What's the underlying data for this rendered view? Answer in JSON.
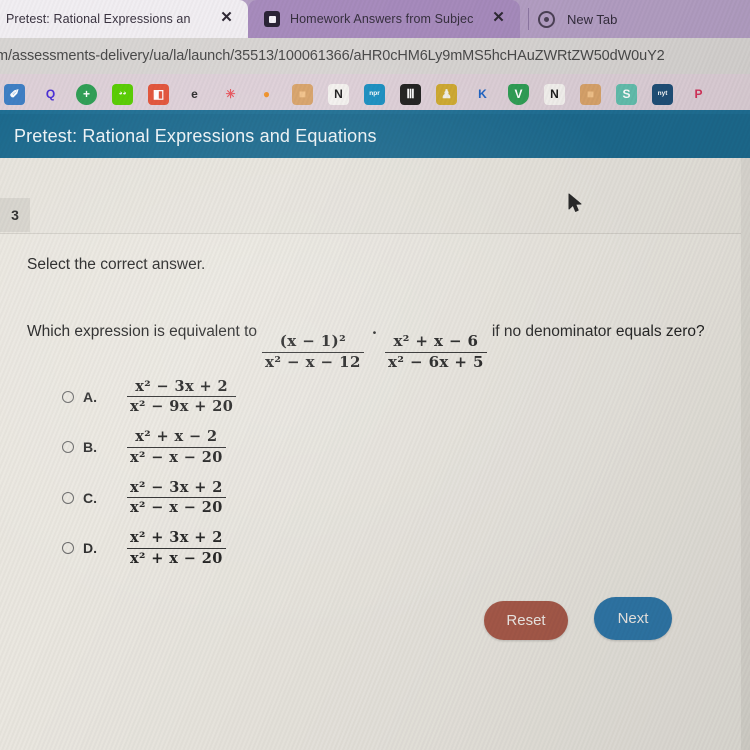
{
  "browser": {
    "tabs": [
      {
        "title": "Pretest: Rational Expressions an",
        "close": "✕",
        "favicon": "none",
        "active": true
      },
      {
        "title": "Homework Answers from Subjec",
        "close": "✕",
        "favicon": "brainly-icon",
        "active": false
      }
    ],
    "new_tab_label": "New Tab",
    "url": "m/assessments-delivery/ua/la/launch/35513/100061366/aHR0cHM6Ly9mMS5hcHAuZWRtZW50dW0uY2",
    "bookmarks": [
      {
        "name": "bookmark-docs",
        "glyph": "✐",
        "bg": "#3f7fc4",
        "fg": "#ffffff",
        "shape": "square"
      },
      {
        "name": "bookmark-quizlet",
        "glyph": "Q",
        "bg": "#ded0d8",
        "fg": "#4a2fd6",
        "shape": "square"
      },
      {
        "name": "bookmark-addplus",
        "glyph": "+",
        "bg": "#2f9e55",
        "fg": "#ffffff",
        "shape": "round"
      },
      {
        "name": "bookmark-duolingo",
        "glyph": "◕◕",
        "bg": "#58cc02",
        "fg": "#ffffff",
        "shape": "square"
      },
      {
        "name": "bookmark-office",
        "glyph": "◧",
        "bg": "#e2543a",
        "fg": "#ffffff",
        "shape": "square"
      },
      {
        "name": "bookmark-edge",
        "glyph": "e",
        "bg": "#ded0d8",
        "fg": "#2b2b2b",
        "shape": "round"
      },
      {
        "name": "bookmark-asterisk",
        "glyph": "✳",
        "bg": "#ded0d8",
        "fg": "#e8545c",
        "shape": "round"
      },
      {
        "name": "bookmark-balloon",
        "glyph": "●",
        "bg": "#ded0d8",
        "fg": "#f0922a",
        "shape": "round"
      },
      {
        "name": "bookmark-photo",
        "glyph": "■",
        "bg": "#d8a36a",
        "fg": "#f2c28a",
        "shape": "square"
      },
      {
        "name": "bookmark-notion",
        "glyph": "N",
        "bg": "#f4f2ef",
        "fg": "#1d1d1d",
        "shape": "square"
      },
      {
        "name": "bookmark-npr",
        "glyph": "npr",
        "bg": "#1a8fc1",
        "fg": "#ffffff",
        "shape": "square"
      },
      {
        "name": "bookmark-columns",
        "glyph": "Ⅲ",
        "bg": "#20201f",
        "fg": "#ffffff",
        "shape": "square"
      },
      {
        "name": "bookmark-person",
        "glyph": "♟",
        "bg": "#cfa92f",
        "fg": "#f2f0e6",
        "shape": "square"
      },
      {
        "name": "bookmark-kaplan",
        "glyph": "K",
        "bg": "#ded0d8",
        "fg": "#1d63c4",
        "shape": "square"
      },
      {
        "name": "bookmark-vpnshield",
        "glyph": "V",
        "bg": "#2f9e55",
        "fg": "#ffffff",
        "shape": "shield"
      },
      {
        "name": "bookmark-notion-2",
        "glyph": "N",
        "bg": "#f4f2ef",
        "fg": "#1d1d1d",
        "shape": "square"
      },
      {
        "name": "bookmark-photo-2",
        "glyph": "■",
        "bg": "#d8a36a",
        "fg": "#f2c28a",
        "shape": "square"
      },
      {
        "name": "bookmark-sheets",
        "glyph": "S",
        "bg": "#63bfae",
        "fg": "#ffffff",
        "shape": "square"
      },
      {
        "name": "bookmark-nyt",
        "glyph": "nyt",
        "bg": "#1f4f78",
        "fg": "#ffffff",
        "shape": "square"
      },
      {
        "name": "bookmark-pinterest",
        "glyph": "P",
        "bg": "#ded0d8",
        "fg": "#d4325a",
        "shape": "round"
      }
    ]
  },
  "page": {
    "title": "Pretest: Rational Expressions and Equations",
    "question_number": "3",
    "instruction": "Select the correct answer.",
    "question": {
      "lead_text": "Which expression is equivalent to",
      "expr1": {
        "numerator": "(x − 1)²",
        "denominator": "x² − x − 12"
      },
      "operator": "·",
      "expr2": {
        "numerator": "x² + x − 6",
        "denominator": "x² − 6x + 5"
      },
      "trail_text": "if no denominator equals zero?"
    },
    "choices": [
      {
        "letter": "A.",
        "numerator": "x² − 3x + 2",
        "denominator": "x² − 9x + 20",
        "selected": false
      },
      {
        "letter": "B.",
        "numerator": "x² + x − 2",
        "denominator": "x² − x − 20",
        "selected": false
      },
      {
        "letter": "C.",
        "numerator": "x² − 3x + 2",
        "denominator": "x² − x − 20",
        "selected": false
      },
      {
        "letter": "D.",
        "numerator": "x² + 3x + 2",
        "denominator": "x² + x − 20",
        "selected": false
      }
    ],
    "buttons": {
      "reset": "Reset",
      "next": "Next"
    }
  },
  "colors": {
    "header_teal": "#1c6a8e",
    "reset_red": "#a85a4a",
    "next_blue": "#2f78aa",
    "tab_purple": "#b49fc4"
  }
}
